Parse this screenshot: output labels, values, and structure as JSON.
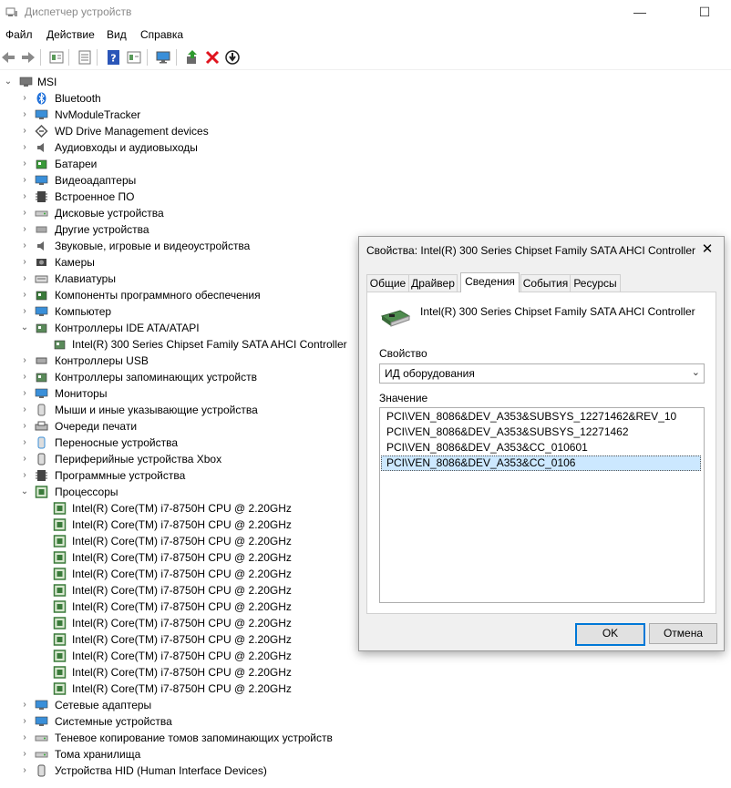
{
  "window": {
    "title": "Диспетчер устройств",
    "minimize_glyph": "—",
    "maximize_glyph": "☐"
  },
  "menu": [
    "Файл",
    "Действие",
    "Вид",
    "Справка"
  ],
  "toolbar": {
    "icons": [
      "back-icon",
      "forward-icon",
      "properties-icon",
      "view-icon",
      "help-icon",
      "panel-icon",
      "monitor-icon",
      "update-driver-icon",
      "uninstall-icon",
      "download-icon"
    ]
  },
  "tree": {
    "root": "MSI",
    "categories": [
      {
        "label": "Bluetooth",
        "icon": "bluetooth-icon",
        "color": "#1e6fd9"
      },
      {
        "label": "NvModuleTracker",
        "icon": "monitor-icon",
        "color": "#3a8fd9"
      },
      {
        "label": "WD Drive Management devices",
        "icon": "diamond-icon",
        "color": "#555555"
      },
      {
        "label": "Аудиовходы и аудиовыходы",
        "icon": "speaker-icon",
        "color": "#666666"
      },
      {
        "label": "Батареи",
        "icon": "battery-icon",
        "color": "#3a9a3a"
      },
      {
        "label": "Видеоадаптеры",
        "icon": "display-adapter-icon",
        "color": "#3a8fd9"
      },
      {
        "label": "Встроенное ПО",
        "icon": "firmware-icon",
        "color": "#444444"
      },
      {
        "label": "Дисковые устройства",
        "icon": "disk-icon",
        "color": "#777777"
      },
      {
        "label": "Другие устройства",
        "icon": "unknown-device-icon",
        "color": "#777777"
      },
      {
        "label": "Звуковые, игровые и видеоустройства",
        "icon": "speaker-icon",
        "color": "#666666"
      },
      {
        "label": "Камеры",
        "icon": "camera-icon",
        "color": "#444444"
      },
      {
        "label": "Клавиатуры",
        "icon": "keyboard-icon",
        "color": "#666666"
      },
      {
        "label": "Компоненты программного обеспечения",
        "icon": "software-icon",
        "color": "#3a7a3a"
      },
      {
        "label": "Компьютер",
        "icon": "computer-icon",
        "color": "#3a8fd9"
      },
      {
        "label": "Контроллеры IDE ATA/ATAPI",
        "icon": "ide-controller-icon",
        "color": "#5a8a5a",
        "expanded": true,
        "children": [
          "Intel(R) 300 Series Chipset Family SATA AHCI Controller"
        ]
      },
      {
        "label": "Контроллеры USB",
        "icon": "usb-icon",
        "color": "#555555"
      },
      {
        "label": "Контроллеры запоминающих устройств",
        "icon": "storage-controller-icon",
        "color": "#5a8a5a"
      },
      {
        "label": "Мониторы",
        "icon": "monitor-icon",
        "color": "#3a8fd9"
      },
      {
        "label": "Мыши и иные указывающие устройства",
        "icon": "mouse-icon",
        "color": "#666666"
      },
      {
        "label": "Очереди печати",
        "icon": "printer-icon",
        "color": "#555555"
      },
      {
        "label": "Переносные устройства",
        "icon": "portable-device-icon",
        "color": "#3a8fd9"
      },
      {
        "label": "Периферийные устройства Xbox",
        "icon": "xbox-icon",
        "color": "#555555"
      },
      {
        "label": "Программные устройства",
        "icon": "software-device-icon",
        "color": "#444444"
      },
      {
        "label": "Процессоры",
        "icon": "cpu-icon",
        "color": "#3a7a3a",
        "expanded": true,
        "children": [
          "Intel(R) Core(TM) i7-8750H CPU @ 2.20GHz",
          "Intel(R) Core(TM) i7-8750H CPU @ 2.20GHz",
          "Intel(R) Core(TM) i7-8750H CPU @ 2.20GHz",
          "Intel(R) Core(TM) i7-8750H CPU @ 2.20GHz",
          "Intel(R) Core(TM) i7-8750H CPU @ 2.20GHz",
          "Intel(R) Core(TM) i7-8750H CPU @ 2.20GHz",
          "Intel(R) Core(TM) i7-8750H CPU @ 2.20GHz",
          "Intel(R) Core(TM) i7-8750H CPU @ 2.20GHz",
          "Intel(R) Core(TM) i7-8750H CPU @ 2.20GHz",
          "Intel(R) Core(TM) i7-8750H CPU @ 2.20GHz",
          "Intel(R) Core(TM) i7-8750H CPU @ 2.20GHz",
          "Intel(R) Core(TM) i7-8750H CPU @ 2.20GHz"
        ]
      },
      {
        "label": "Сетевые адаптеры",
        "icon": "network-adapter-icon",
        "color": "#3a8fd9"
      },
      {
        "label": "Системные устройства",
        "icon": "system-device-icon",
        "color": "#3a8fd9"
      },
      {
        "label": "Теневое копирование томов запоминающих устройств",
        "icon": "volume-shadow-icon",
        "color": "#777777"
      },
      {
        "label": "Тома хранилища",
        "icon": "storage-volume-icon",
        "color": "#777777"
      },
      {
        "label": "Устройства HID (Human Interface Devices)",
        "icon": "hid-icon",
        "color": "#555555"
      }
    ]
  },
  "dialog": {
    "title": "Свойства: Intel(R) 300 Series Chipset Family SATA AHCI Controller",
    "close_glyph": "✕",
    "tabs": [
      "Общие",
      "Драйвер",
      "Сведения",
      "События",
      "Ресурсы"
    ],
    "active_tab": 2,
    "device_name": "Intel(R) 300 Series Chipset Family SATA AHCI Controller",
    "property_label": "Свойство",
    "property_value": "ИД оборудования",
    "value_label": "Значение",
    "values": [
      "PCI\\VEN_8086&DEV_A353&SUBSYS_12271462&REV_10",
      "PCI\\VEN_8086&DEV_A353&SUBSYS_12271462",
      "PCI\\VEN_8086&DEV_A353&CC_010601",
      "PCI\\VEN_8086&DEV_A353&CC_0106"
    ],
    "selected_value": 3,
    "ok_label": "OK",
    "cancel_label": "Отмена"
  }
}
